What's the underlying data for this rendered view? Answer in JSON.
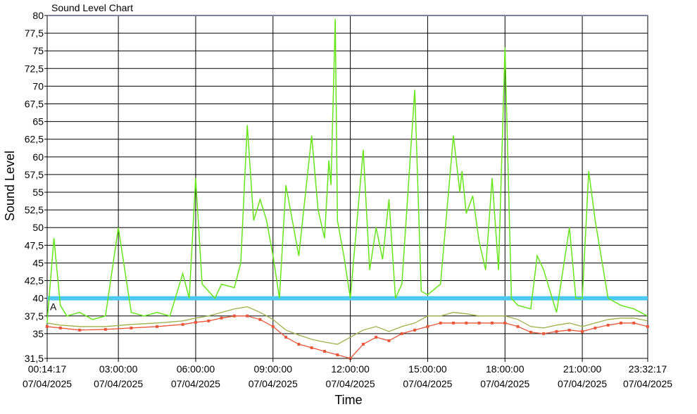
{
  "chart_data": {
    "type": "line",
    "title": "Sound Level Chart",
    "xlabel": "Time",
    "ylabel": "Sound Level",
    "ylim": [
      31.5,
      80
    ],
    "xlim": [
      "2025-04-07 00:14:17",
      "2025-04-07 23:32:17"
    ],
    "grid": true,
    "yticks": [
      "80",
      "77,5",
      "75",
      "72,5",
      "70",
      "67,5",
      "65",
      "62,5",
      "60",
      "57,5",
      "55",
      "52,5",
      "50",
      "47,5",
      "45",
      "42,5",
      "40",
      "37,5",
      "35",
      "31,5"
    ],
    "xticks": [
      {
        "time": "00:14:17",
        "date": "07/04/2025"
      },
      {
        "time": "03:00:00",
        "date": "07/04/2025"
      },
      {
        "time": "06:00:00",
        "date": "07/04/2025"
      },
      {
        "time": "09:00:00",
        "date": "07/04/2025"
      },
      {
        "time": "12:00:00",
        "date": "07/04/2025"
      },
      {
        "time": "15:00:00",
        "date": "07/04/2025"
      },
      {
        "time": "18:00:00",
        "date": "07/04/2025"
      },
      {
        "time": "21:00:00",
        "date": "07/04/2025"
      },
      {
        "time": "23:32:17",
        "date": "07/04/2025"
      }
    ],
    "threshold": {
      "label": "A",
      "value": 40,
      "color": "#4dc8f0"
    },
    "series": [
      {
        "kind": "max",
        "color": "#66e61a",
        "x": [
          "00:14",
          "00:30",
          "00:45",
          "01:00",
          "01:30",
          "02:00",
          "02:30",
          "03:00",
          "03:30",
          "04:00",
          "04:30",
          "05:00",
          "05:30",
          "05:45",
          "06:00",
          "06:15",
          "06:30",
          "06:45",
          "07:00",
          "07:30",
          "07:45",
          "08:00",
          "08:15",
          "08:30",
          "08:45",
          "09:00",
          "09:15",
          "09:30",
          "10:00",
          "10:30",
          "10:45",
          "11:00",
          "11:10",
          "11:15",
          "11:25",
          "11:30",
          "11:45",
          "12:00",
          "12:30",
          "12:45",
          "13:00",
          "13:15",
          "13:30",
          "13:45",
          "14:00",
          "14:30",
          "14:45",
          "15:00",
          "15:30",
          "16:00",
          "16:15",
          "16:20",
          "16:30",
          "16:45",
          "17:00",
          "17:15",
          "17:30",
          "17:45",
          "18:00",
          "18:15",
          "18:30",
          "19:00",
          "19:15",
          "19:30",
          "20:00",
          "20:30",
          "20:45",
          "21:00",
          "21:15",
          "21:30",
          "22:00",
          "22:30",
          "23:00",
          "23:32"
        ],
        "y": [
          36.5,
          48.5,
          39,
          37.5,
          38,
          37,
          37.5,
          50,
          38,
          37.5,
          38,
          37.5,
          43.5,
          40,
          57,
          42,
          41,
          40,
          42,
          41.5,
          45,
          64.5,
          51,
          54,
          51,
          46,
          40,
          56,
          46,
          63,
          52.5,
          48.5,
          59.5,
          56,
          79.5,
          51,
          46,
          40,
          61,
          44,
          50,
          45.5,
          54,
          40,
          42,
          69.5,
          41,
          40.5,
          42,
          63,
          55,
          58,
          52,
          54.5,
          48,
          44,
          57,
          44,
          75.5,
          40,
          39,
          38.5,
          46,
          44,
          38,
          50,
          40,
          40,
          58,
          51,
          40,
          39,
          38.5,
          37.5
        ]
      },
      {
        "kind": "average",
        "color": "#9bb24a",
        "x": [
          "00:14",
          "00:45",
          "01:30",
          "02:30",
          "03:30",
          "04:30",
          "05:30",
          "06:00",
          "06:30",
          "07:00",
          "07:30",
          "08:00",
          "08:30",
          "09:00",
          "09:30",
          "10:00",
          "10:30",
          "11:00",
          "11:30",
          "12:00",
          "12:30",
          "13:00",
          "13:30",
          "14:00",
          "14:30",
          "15:00",
          "15:30",
          "16:00",
          "16:30",
          "17:00",
          "17:30",
          "18:00",
          "18:30",
          "19:00",
          "19:30",
          "20:00",
          "20:30",
          "21:00",
          "21:30",
          "22:00",
          "22:30",
          "23:00",
          "23:32"
        ],
        "y": [
          36.5,
          36.2,
          36,
          36,
          36.3,
          36.5,
          36.8,
          37.2,
          37.5,
          38,
          38.5,
          38.8,
          38,
          37,
          35.5,
          34.8,
          34.2,
          33.8,
          33.5,
          34.5,
          35.5,
          36,
          35.3,
          36,
          36.5,
          37.5,
          37.5,
          38,
          37.8,
          37.5,
          37.5,
          37.5,
          37,
          36,
          35.8,
          36.2,
          36.5,
          36,
          36.5,
          37,
          37.2,
          37.2,
          36.8
        ]
      },
      {
        "kind": "min",
        "color": "#e8573a",
        "x": [
          "00:14",
          "00:45",
          "01:30",
          "02:30",
          "03:30",
          "04:30",
          "05:30",
          "06:00",
          "06:30",
          "07:00",
          "07:30",
          "08:00",
          "08:30",
          "09:00",
          "09:30",
          "10:00",
          "10:30",
          "11:00",
          "11:30",
          "12:00",
          "12:30",
          "13:00",
          "13:30",
          "14:00",
          "14:30",
          "15:00",
          "15:30",
          "16:00",
          "16:30",
          "17:00",
          "17:30",
          "18:00",
          "18:30",
          "19:00",
          "19:30",
          "20:00",
          "20:30",
          "21:00",
          "21:30",
          "22:00",
          "22:30",
          "23:00",
          "23:32"
        ],
        "y": [
          36,
          35.8,
          35.5,
          35.6,
          35.8,
          36,
          36.3,
          36.6,
          36.8,
          37.2,
          37.5,
          37.5,
          37,
          36,
          34.5,
          33.5,
          33,
          32.5,
          32,
          31.5,
          33.5,
          34.5,
          34,
          35,
          35.5,
          36,
          36.5,
          36.5,
          36.5,
          36.5,
          36.5,
          36.5,
          36,
          35.2,
          35,
          35.3,
          35.5,
          35.3,
          35.8,
          36.2,
          36.5,
          36.5,
          36
        ]
      }
    ]
  }
}
